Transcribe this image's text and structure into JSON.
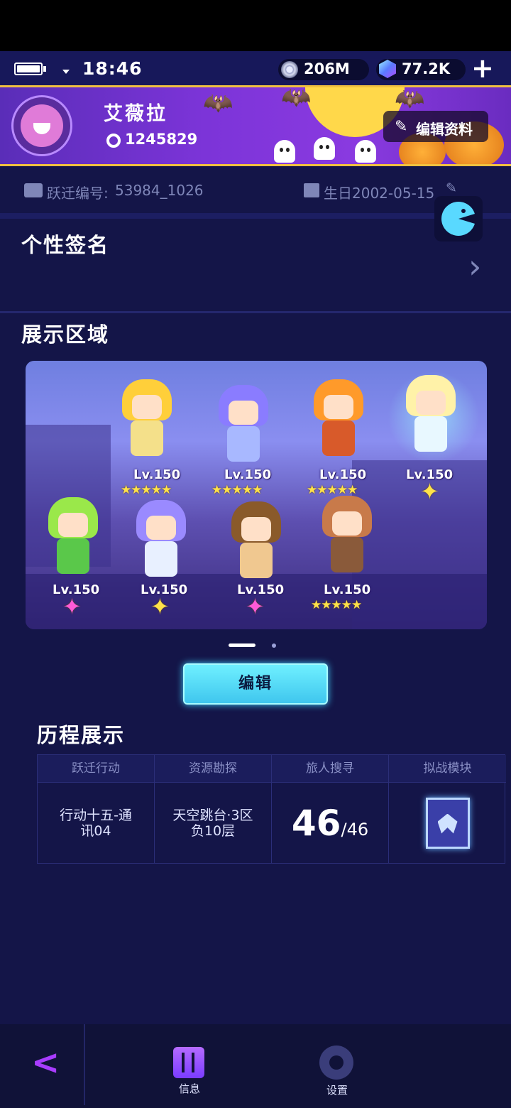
{
  "status_bar": {
    "time": "18:46",
    "coins": "206M",
    "gems": "77.2K",
    "plus": "+"
  },
  "profile": {
    "name": "艾薇拉",
    "uid": "1245829",
    "edit_label": "编辑资料",
    "id_label": "跃迁编号:",
    "id_value": "53984_1026",
    "birthday": "生日2002-05-15"
  },
  "signature": {
    "title": "个性签名"
  },
  "showcase": {
    "title": "展示区域",
    "characters": [
      {
        "level": "Lv.150",
        "stars": "★★★★★",
        "hair": "#ffcf3a",
        "body": "#f4e08a"
      },
      {
        "level": "Lv.150",
        "stars": "★★★★★",
        "hair": "#8a7cff",
        "body": "#a8b8ff"
      },
      {
        "level": "Lv.150",
        "stars": "★★★★★",
        "hair": "#ff9a2a",
        "body": "#d85a2a"
      },
      {
        "level": "Lv.150",
        "stars": "✦",
        "hair": "#fff2a8",
        "body": "#e8f8ff"
      },
      {
        "level": "Lv.150",
        "stars": "✦",
        "hair": "#9ae84a",
        "body": "#5ac84a"
      },
      {
        "level": "Lv.150",
        "stars": "✦",
        "hair": "#9a8aff",
        "body": "#e8f0ff"
      },
      {
        "level": "Lv.150",
        "stars": "✦",
        "hair": "#8a5a2a",
        "body": "#f0c890"
      },
      {
        "level": "Lv.150",
        "stars": "★★★★★",
        "hair": "#c87a4a",
        "body": "#8a5a3a"
      }
    ],
    "star_colors": [
      "#ffe24a",
      "#ffe24a",
      "#ffe24a",
      "#ffe24a",
      "#ff5ad8",
      "#ffe24a",
      "#ff5ad8",
      "#ffe24a"
    ],
    "edit_button": "编辑"
  },
  "history": {
    "title": "历程展示",
    "headers": [
      "跃迁行动",
      "资源勘探",
      "旅人搜寻",
      "拟战模块"
    ],
    "col1": "行动十五-通\n讯04",
    "col2": "天空跳台·3区\n负10层",
    "col3_num": "46",
    "col3_total": "/46"
  },
  "nav": {
    "back": "<",
    "info": "信息",
    "settings": "设置"
  }
}
